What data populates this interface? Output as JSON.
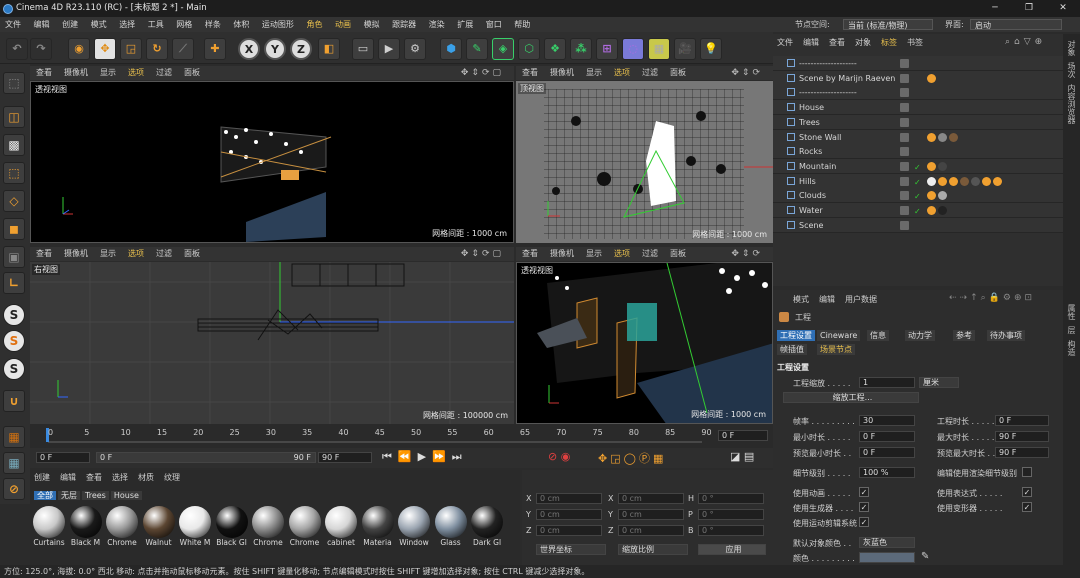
{
  "title": "Cinema 4D R23.110 (RC) - [未标题 2 *] - Main",
  "menu": [
    "文件",
    "编辑",
    "创建",
    "模式",
    "选择",
    "工具",
    "网格",
    "样条",
    "体积",
    "运动图形",
    "角色",
    "动画",
    "模拟",
    "跟踪器",
    "渲染",
    "扩展",
    "窗口",
    "帮助"
  ],
  "node_space_label": "节点空间:",
  "node_space_value": "当前 (标准/物理)",
  "layout_label": "界面:",
  "layout_value": "启动",
  "viewport_menu": [
    "查看",
    "摄像机",
    "显示",
    "选项",
    "过滤",
    "面板"
  ],
  "viewports": [
    {
      "label": "透视视图",
      "grid": "网格间距 : 1000 cm"
    },
    {
      "label": "顶视图",
      "grid": "网格间距 : 1000 cm"
    },
    {
      "label": "右视图",
      "grid": "网格间距 : 100000 cm"
    },
    {
      "label": "透视视图",
      "grid": "网格间距 : 1000 cm"
    }
  ],
  "obj_menu": [
    "文件",
    "编辑",
    "查看",
    "对象",
    "标签",
    "书签"
  ],
  "objects": [
    {
      "name": "--------------------"
    },
    {
      "name": "Scene by Marijn Raeven"
    },
    {
      "name": "--------------------"
    },
    {
      "name": "House"
    },
    {
      "name": "Trees"
    },
    {
      "name": "Stone Wall"
    },
    {
      "name": "Rocks"
    },
    {
      "name": "Mountain"
    },
    {
      "name": "Hills"
    },
    {
      "name": "Clouds"
    },
    {
      "name": "Water"
    },
    {
      "name": "Scene"
    }
  ],
  "attr_menu": [
    "模式",
    "编辑",
    "用户数据"
  ],
  "attr_title": "工程",
  "attr_tabs": [
    "工程设置",
    "Cineware",
    "信息",
    "动力学",
    "参考",
    "待办事项",
    "帧插值",
    "场景节点"
  ],
  "section": "工程设置",
  "project_scale_label": "工程缩放 . . . . .",
  "project_scale_value": "1",
  "project_scale_unit": "厘米",
  "scale_project_btn": "缩放工程...",
  "fps_label": "帧率 . . . . . . . . .",
  "fps_value": "30",
  "proj_time_label": "工程时长 . . . . . .",
  "proj_time_value": "0 F",
  "min_time_label": "最小时长 . . . . .",
  "min_time_value": "0 F",
  "max_time_label": "最大时长 . . . . . .",
  "max_time_value": "90 F",
  "prev_min_label": "预览最小时长 . .",
  "prev_min_value": "0 F",
  "prev_max_label": "预览最大时长 . . .",
  "prev_max_value": "90 F",
  "lod_label": "细节级别 . . . . .",
  "lod_value": "100 %",
  "render_lod_label": "编辑使用渲染细节级别",
  "use_anim_label": "使用动画 . . . . .",
  "use_expr_label": "使用表达式 . . . . .",
  "use_gen_label": "使用生成器 . . . .",
  "use_deform_label": "使用变形器 . . . . .",
  "use_motion_label": "使用运动剪辑系统",
  "default_color_label": "默认对象颜色 . .",
  "default_color_value": "灰蓝色",
  "color_label": "颜色 . . . . . . . . .",
  "timeline_ticks": [
    "0",
    "5",
    "10",
    "15",
    "20",
    "25",
    "30",
    "35",
    "40",
    "45",
    "50",
    "55",
    "60",
    "65",
    "70",
    "75",
    "80",
    "85",
    "90"
  ],
  "timeline_frame": "0 F",
  "transport_start": "0 F",
  "transport_slider_start": "0 F",
  "transport_slider_end": "90 F",
  "transport_end": "90 F",
  "mat_menu": [
    "创建",
    "编辑",
    "查看",
    "选择",
    "材质",
    "纹理"
  ],
  "mat_filters": [
    "全部",
    "无层",
    "Trees",
    "House"
  ],
  "materials": [
    {
      "name": "Curtains",
      "color": "#c8c8c8"
    },
    {
      "name": "Black M",
      "color": "#1a1a1a"
    },
    {
      "name": "Chrome",
      "color": "#9a9a9a"
    },
    {
      "name": "Walnut",
      "color": "#5c4632"
    },
    {
      "name": "White M",
      "color": "#e8e8e8"
    },
    {
      "name": "Black Gl",
      "color": "#111111"
    },
    {
      "name": "Chrome",
      "color": "#8d8d8d"
    },
    {
      "name": "Chrome",
      "color": "#a5a5a5"
    },
    {
      "name": "cabinet",
      "color": "#d5d5d5"
    },
    {
      "name": "Materia",
      "color": "#444444"
    },
    {
      "name": "Window",
      "color": "#9aa4b0"
    },
    {
      "name": "Glass",
      "color": "#7f8fa0"
    },
    {
      "name": "Dark Gl",
      "color": "#222222"
    }
  ],
  "coord_labels": [
    "X",
    "Y",
    "Z",
    "X",
    "Y",
    "Z",
    "H",
    "P",
    "B"
  ],
  "coord_values": [
    "0 cm",
    "0 cm",
    "0 cm",
    "0 cm",
    "0 cm",
    "0 cm",
    "0 °",
    "0 °",
    "0 °"
  ],
  "coord_world": "世界坐标",
  "coord_scale": "缩放比例",
  "coord_apply": "应用",
  "status_text": "方位: 125.0°, 海拔: 0.0° 西北        移动: 点击并拖动鼠标移动元素。按住 SHIFT 键量化移动; 节点编辑模式时按住 SHIFT 键增加选择对象; 按住 CTRL 键减少选择对象。",
  "right_strip": [
    "对象",
    "场次",
    "内容浏览器"
  ],
  "right_strip2": [
    "属性",
    "层",
    "构造"
  ]
}
